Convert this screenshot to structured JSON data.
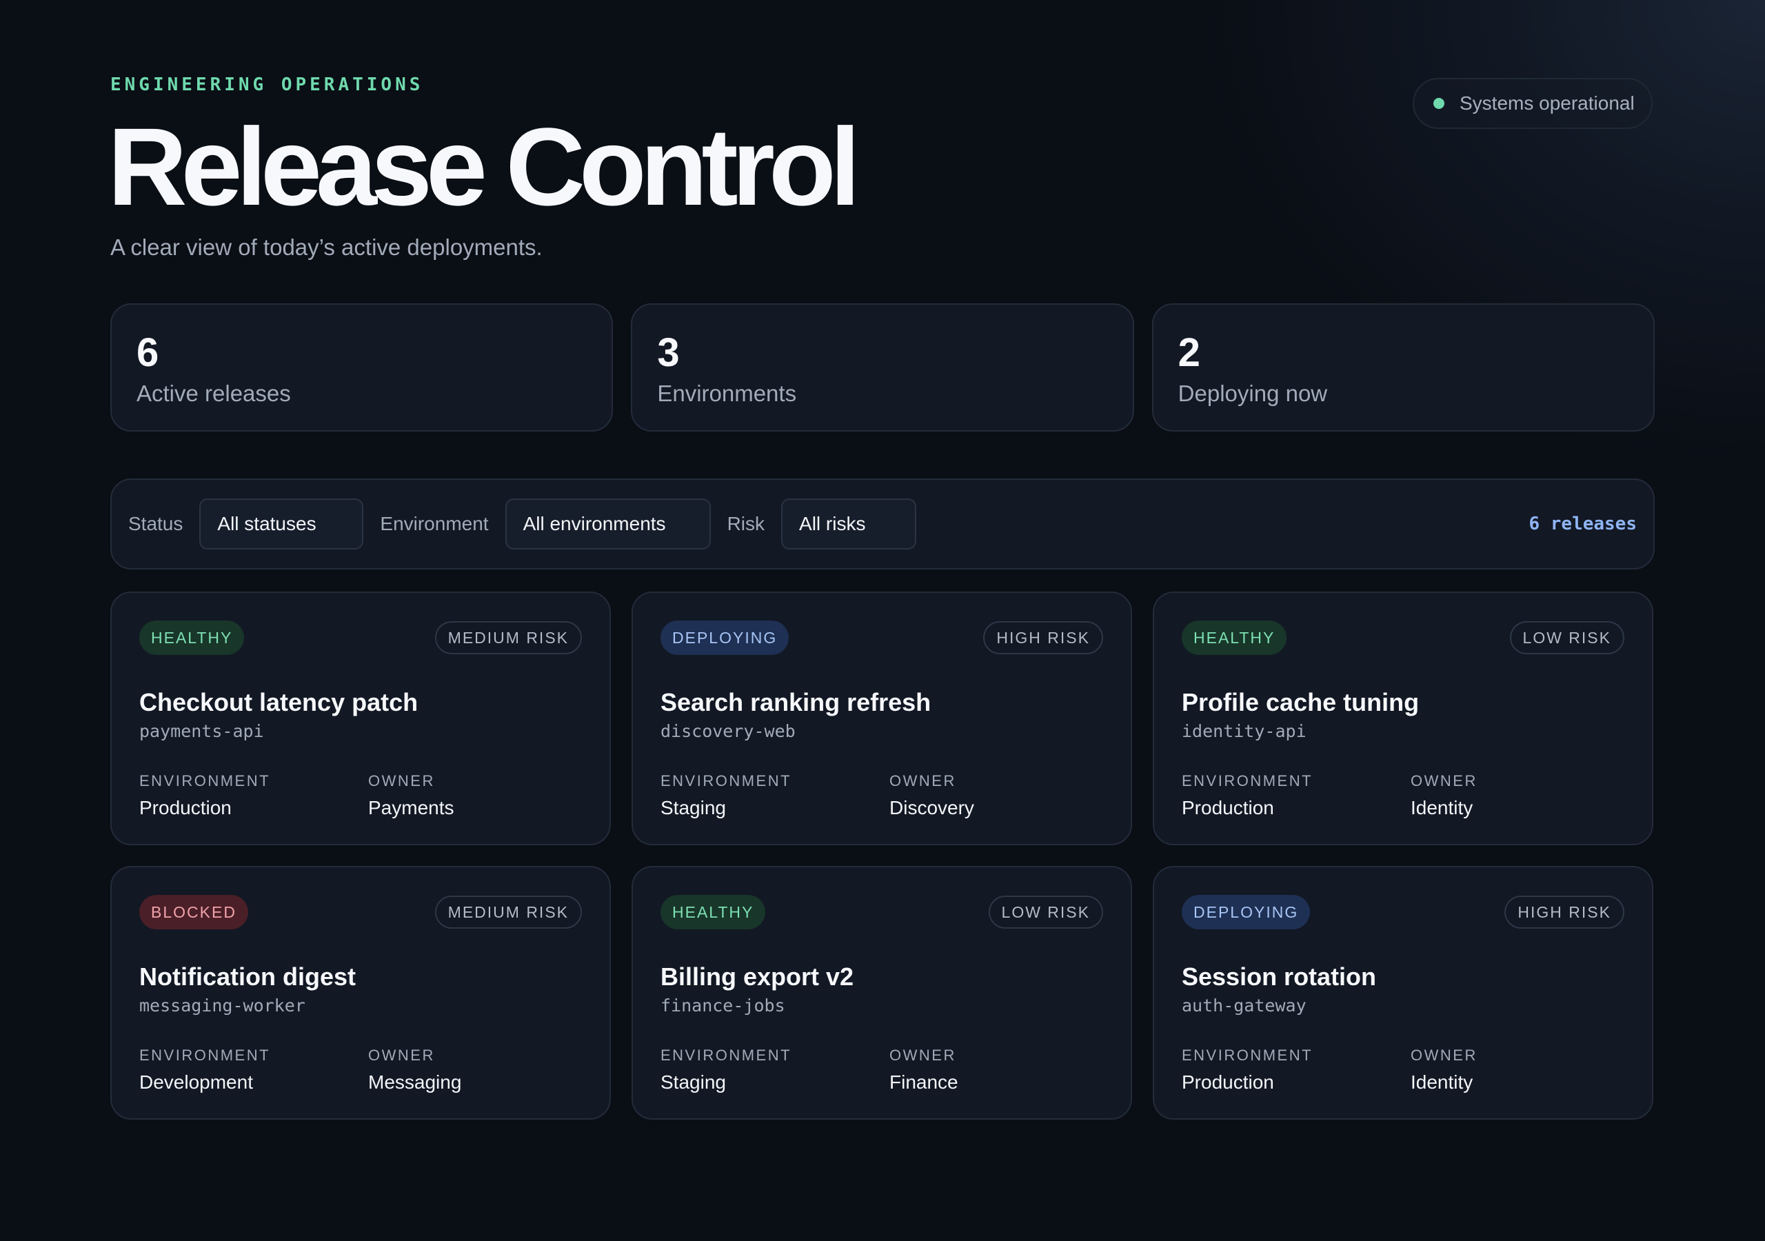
{
  "header": {
    "eyebrow": "ENGINEERING OPERATIONS",
    "title": "Release Control",
    "subtitle": "A clear view of today’s active deployments.",
    "system_status": "Systems operational"
  },
  "stats": [
    {
      "value": "6",
      "label": "Active releases"
    },
    {
      "value": "3",
      "label": "Environments"
    },
    {
      "value": "2",
      "label": "Deploying now"
    }
  ],
  "filters": {
    "status_label": "Status",
    "status_value": "All statuses",
    "environment_label": "Environment",
    "environment_value": "All environments",
    "risk_label": "Risk",
    "risk_value": "All risks",
    "count": "6 releases"
  },
  "labels": {
    "environment": "ENVIRONMENT",
    "owner": "OWNER"
  },
  "releases": [
    {
      "status": "HEALTHY",
      "risk": "MEDIUM RISK",
      "title": "Checkout latency patch",
      "service": "payments-api",
      "environment": "Production",
      "owner": "Payments"
    },
    {
      "status": "DEPLOYING",
      "risk": "HIGH RISK",
      "title": "Search ranking refresh",
      "service": "discovery-web",
      "environment": "Staging",
      "owner": "Discovery"
    },
    {
      "status": "HEALTHY",
      "risk": "LOW RISK",
      "title": "Profile cache tuning",
      "service": "identity-api",
      "environment": "Production",
      "owner": "Identity"
    },
    {
      "status": "BLOCKED",
      "risk": "MEDIUM RISK",
      "title": "Notification digest",
      "service": "messaging-worker",
      "environment": "Development",
      "owner": "Messaging"
    },
    {
      "status": "HEALTHY",
      "risk": "LOW RISK",
      "title": "Billing export v2",
      "service": "finance-jobs",
      "environment": "Staging",
      "owner": "Finance"
    },
    {
      "status": "DEPLOYING",
      "risk": "HIGH RISK",
      "title": "Session rotation",
      "service": "auth-gateway",
      "environment": "Production",
      "owner": "Identity"
    }
  ],
  "colors": {
    "accent": "#6fd9ad",
    "healthy": "#7ee0b4",
    "deploying": "#a8c5f5",
    "blocked": "#f2a3ab",
    "count": "#8fb5f5"
  }
}
